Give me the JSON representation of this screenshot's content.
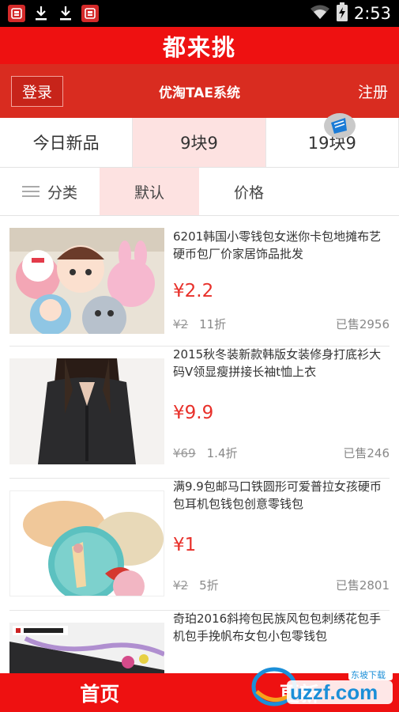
{
  "status_bar": {
    "time": "2:53",
    "icons": [
      "app-badge-icon",
      "download-icon",
      "download-icon",
      "app-badge-icon",
      "wifi-icon",
      "battery-charging-icon"
    ]
  },
  "app_title": "都来挑",
  "nav": {
    "login": "登录",
    "title": "优淘TAE系统",
    "register": "注册"
  },
  "category_tabs": [
    {
      "label": "今日新品",
      "active": false
    },
    {
      "label": "9块9",
      "active": true
    },
    {
      "label": "19块9",
      "active": false
    }
  ],
  "sort_bar": [
    {
      "label": "分类",
      "active": false
    },
    {
      "label": "默认",
      "active": true
    },
    {
      "label": "价格",
      "active": false
    }
  ],
  "products": [
    {
      "title": "6201韩国小零钱包女迷你卡包地摊布艺硬币包厂价家居饰品批发",
      "price": "¥2.2",
      "old_price": "¥2",
      "discount": "11折",
      "sold": "已售2956"
    },
    {
      "title": "2015秋冬装新款韩版女装修身打底衫大码V领显瘦拼接长袖t恤上衣",
      "price": "¥9.9",
      "old_price": "¥69",
      "discount": "1.4折",
      "sold": "已售246"
    },
    {
      "title": "满9.9包邮马口铁圆形可爱普拉女孩硬币包耳机包钱包创意零钱包",
      "price": "¥1",
      "old_price": "¥2",
      "discount": "5折",
      "sold": "已售2801"
    },
    {
      "title": "奇珀2016斜挎包民族风包包刺绣花包手机包手挽帆布女包小包零钱包",
      "price": "",
      "old_price": "",
      "discount": "",
      "sold": ""
    }
  ],
  "bottom_nav": {
    "home": "首页",
    "update": "更新"
  },
  "watermark": {
    "text": "uzzf.com",
    "tagline": "东坡下载"
  },
  "colors": {
    "brand_red": "#ee1111",
    "nav_red": "#d92c20",
    "price_red": "#e8302a",
    "active_tab_bg": "#fde2e1"
  }
}
